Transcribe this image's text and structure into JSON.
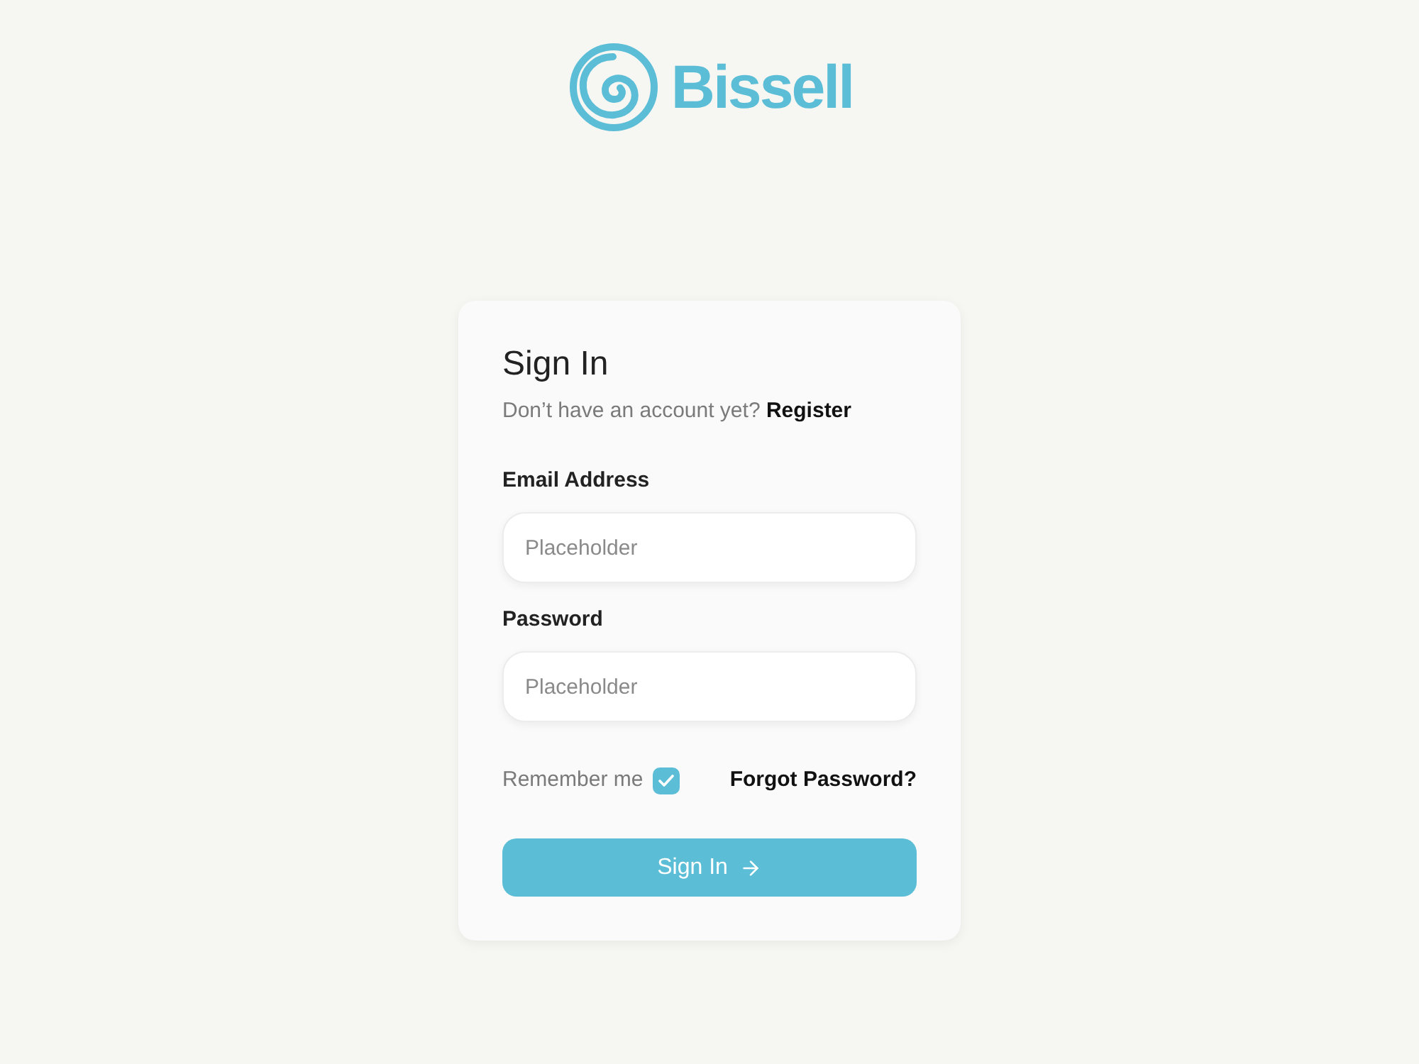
{
  "logo": {
    "name": "Bissell"
  },
  "form": {
    "title": "Sign In",
    "prompt": "Don’t have an account yet?",
    "register_link": "Register",
    "fields": [
      {
        "label": "Email Address",
        "placeholder": "Placeholder"
      },
      {
        "label": "Password",
        "placeholder": "Placeholder"
      }
    ],
    "remember": {
      "label": "Remember me",
      "checked": true
    },
    "forgot_link": "Forgot Password?",
    "submit": {
      "label": "Sign In"
    }
  }
}
